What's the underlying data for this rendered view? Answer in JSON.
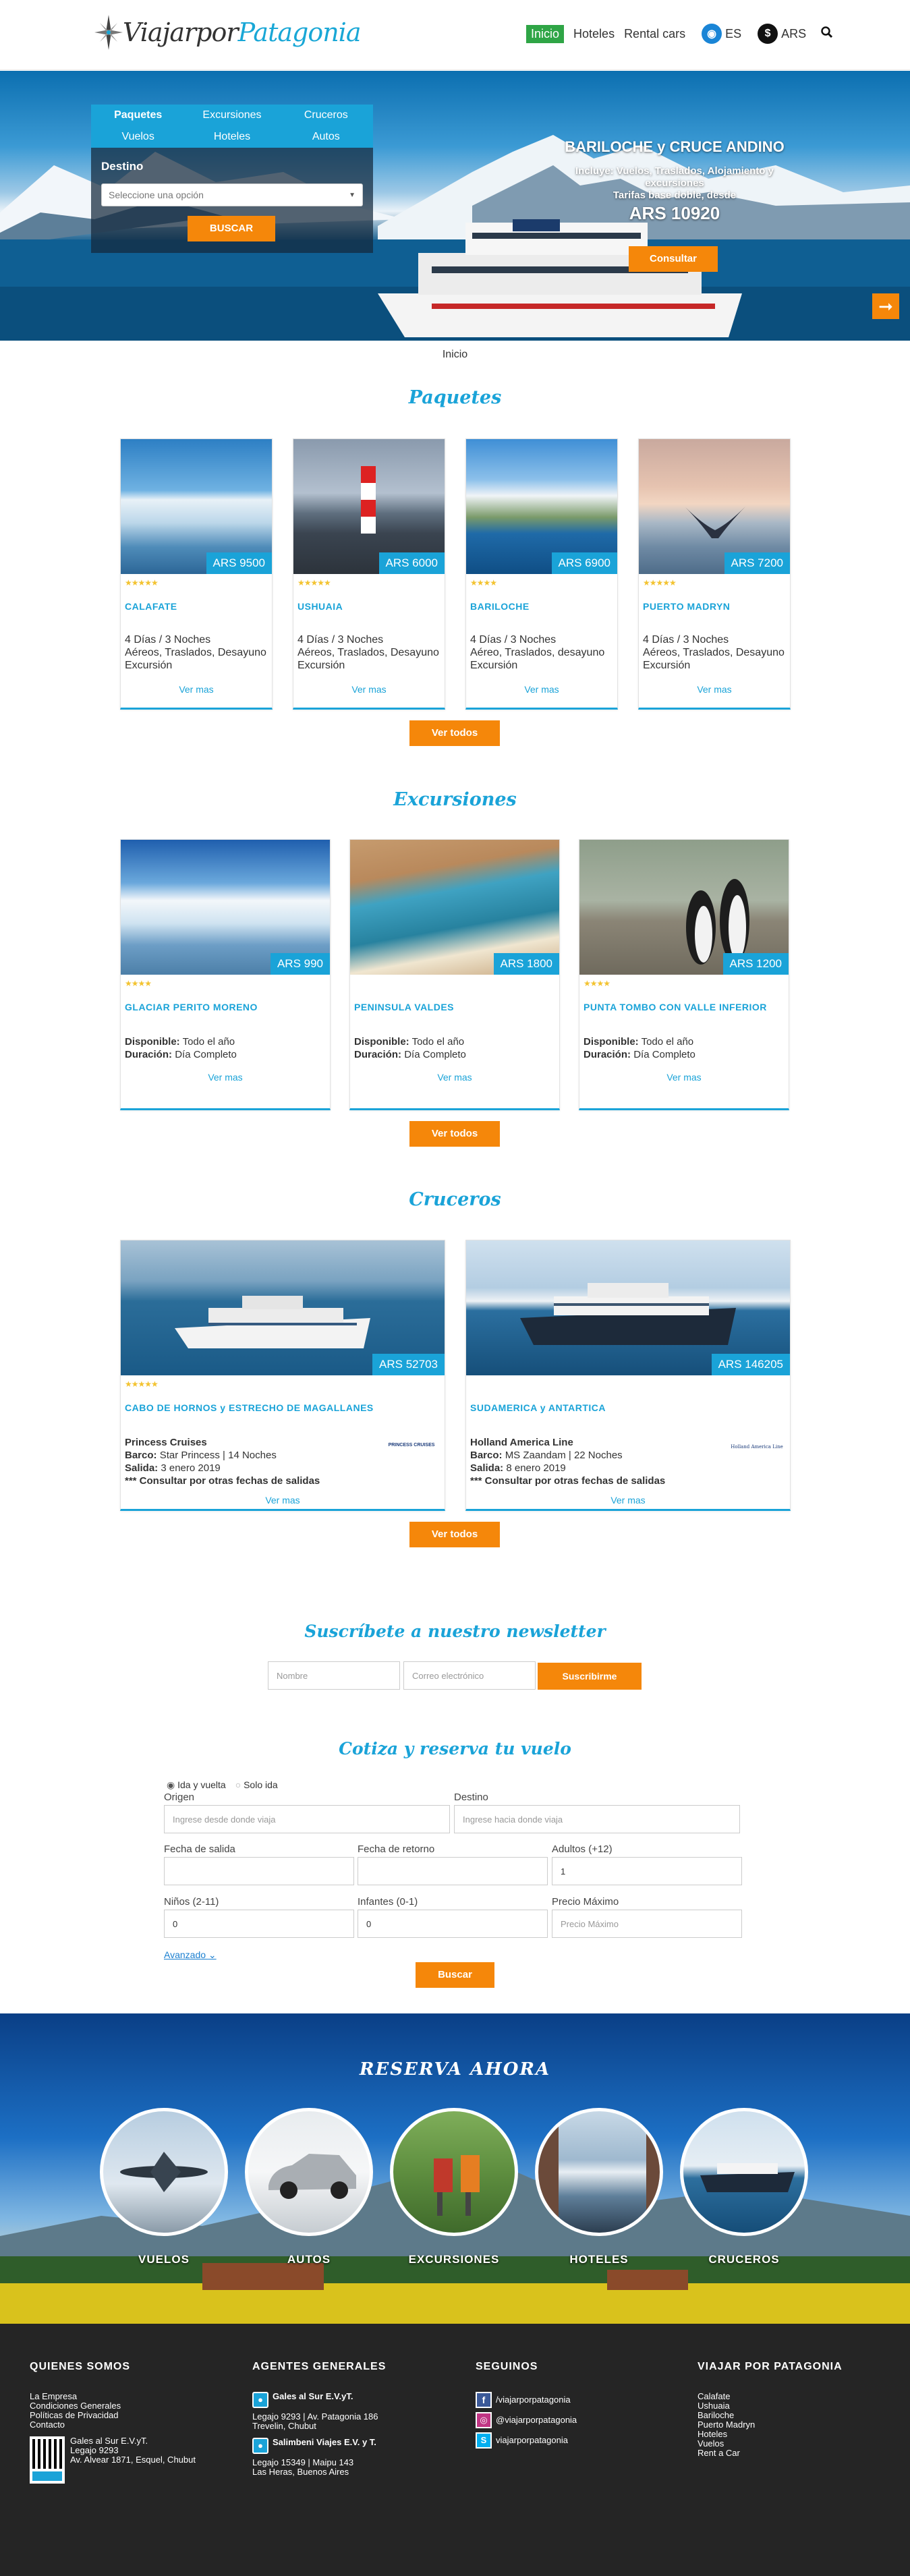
{
  "header": {
    "logo_part1": "Viajarpor",
    "logo_part2": "Patagonia",
    "nav": [
      "Inicio",
      "Hoteles",
      "Rental cars"
    ],
    "lang": "ES",
    "currency": "ARS"
  },
  "hero": {
    "tabs": [
      "Paquetes",
      "Excursiones",
      "Cruceros",
      "Vuelos",
      "Hoteles",
      "Autos"
    ],
    "destino_label": "Destino",
    "destino_placeholder": "Seleccione una opción",
    "buscar": "BUSCAR",
    "promo_title": "BARILOCHE y CRUCE ANDINO",
    "promo_sub1": "Incluye: Vuelos, Traslados, Alojamiento y excursiones",
    "promo_sub2": "Tarifas base doble, desde",
    "promo_price": "ARS 10920",
    "consultar": "Consultar"
  },
  "breadcrumb": "Inicio",
  "paquetes": {
    "title": "Paquetes",
    "items": [
      {
        "name": "CALAFATE",
        "price": "ARS 9500",
        "l1": "4 Días / 3 Noches",
        "l2": "Aéreos, Traslados, Desayuno",
        "l3": "Excursión",
        "more": "Ver mas"
      },
      {
        "name": "USHUAIA",
        "price": "ARS 6000",
        "l1": "4 Días / 3 Noches",
        "l2": "Aéreos, Traslados, Desayuno",
        "l3": "Excursión",
        "more": "Ver mas"
      },
      {
        "name": "BARILOCHE",
        "price": "ARS 6900",
        "l1": "4 Días / 3 Noches",
        "l2": "Aéreo, Traslados, desayuno",
        "l3": "Excursión",
        "more": "Ver mas"
      },
      {
        "name": "PUERTO MADRYN",
        "price": "ARS 7200",
        "l1": "4 Días / 3 Noches",
        "l2": "Aéreos, Traslados, Desayuno",
        "l3": "Excursión",
        "more": "Ver mas"
      }
    ],
    "ver_todos": "Ver todos"
  },
  "excursiones": {
    "title": "Excursiones",
    "disp_label": "Disponible:",
    "dur_label": "Duración:",
    "items": [
      {
        "name": "GLACIAR PERITO MORENO",
        "price": "ARS 990",
        "disp": "Todo el año",
        "dur": "Día Completo",
        "more": "Ver mas"
      },
      {
        "name": "PENINSULA VALDES",
        "price": "ARS 1800",
        "disp": "Todo el año",
        "dur": "Día Completo",
        "more": "Ver mas"
      },
      {
        "name": "PUNTA TOMBO CON VALLE INFERIOR",
        "price": "ARS 1200",
        "disp": "Todo el año",
        "dur": "Día Completo",
        "more": "Ver mas"
      }
    ],
    "ver_todos": "Ver todos"
  },
  "cruceros": {
    "title": "Cruceros",
    "barco_label": "Barco:",
    "salida_label": "Salida:",
    "items": [
      {
        "name": "CABO DE HORNOS y ESTRECHO DE MAGALLANES",
        "price": "ARS 52703",
        "line": "Princess Cruises",
        "barco": "Star Princess | 14 Noches",
        "salida": "3 enero 2019",
        "note": "*** Consultar por otras fechas de salidas",
        "logo": "PRINCESS CRUISES",
        "more": "Ver mas"
      },
      {
        "name": "SUDAMERICA y ANTARTICA",
        "price": "ARS 146205",
        "line": "Holland America Line",
        "barco": "MS Zaandam | 22 Noches",
        "salida": "8 enero 2019",
        "note": "*** Consultar por otras fechas de salidas",
        "logo": "Holland America Line",
        "more": "Ver mas"
      }
    ],
    "ver_todos": "Ver todos"
  },
  "newsletter": {
    "title": "Suscríbete a nuestro newsletter",
    "name_ph": "Nombre",
    "email_ph": "Correo electrónico",
    "submit": "Suscribirme"
  },
  "vuelo": {
    "title": "Cotiza y reserva tu vuelo",
    "ida_vuelta": "Ida y vuelta",
    "solo_ida": "Solo ida",
    "origen": "Origen",
    "origen_ph": "Ingrese desde donde viaja",
    "destino": "Destino",
    "destino_ph": "Ingrese hacia donde viaja",
    "fecha_salida": "Fecha de salida",
    "fecha_retorno": "Fecha de retorno",
    "adultos": "Adultos (+12)",
    "adultos_val": "1",
    "ninos": "Niños (2-11)",
    "ninos_val": "0",
    "infantes": "Infantes (0-1)",
    "infantes_val": "0",
    "precio": "Precio Máximo",
    "precio_ph": "Precio Máximo",
    "avanzado": "Avanzado",
    "buscar": "Buscar"
  },
  "reserva": {
    "title": "RESERVA AHORA",
    "items": [
      "VUELOS",
      "AUTOS",
      "EXCURSIONES",
      "HOTELES",
      "CRUCEROS"
    ]
  },
  "footer": {
    "c1_title": "QUIENES SOMOS",
    "c1_links": [
      "La Empresa",
      "Condiciones Generales",
      "Políticas de Privacidad",
      "Contacto"
    ],
    "c1_legal1": "Gales al Sur E.V.yT.",
    "c1_legal2": "Legajo 9293",
    "c1_legal3": "Av. Alvear 1871, Esquel, Chubut",
    "c2_title": "AGENTES GENERALES",
    "ag1_name": "Gales al Sur E.V.yT.",
    "ag1_l1": "Legajo 9293 | Av. Patagonia 186",
    "ag1_l2": "Trevelin, Chubut",
    "ag2_name": "Salimbeni Viajes E.V. y T.",
    "ag2_l1": "Legajo 15349 | Maipu 143",
    "ag2_l2": "Las Heras, Buenos Aires",
    "c3_title": "SEGUINOS",
    "social": [
      "/viajarporpatagonia",
      "@viajarporpatagonia",
      "viajarporpatagonia"
    ],
    "c4_title": "VIAJAR POR PATAGONIA",
    "c4_links": [
      "Calafate",
      "Ushuaia",
      "Bariloche",
      "Puerto Madryn",
      "Hoteles",
      "Vuelos",
      "Rent a Car"
    ]
  },
  "colors": {
    "accent": "#1aa3d8",
    "orange": "#f5870a",
    "green": "#2fa546",
    "footer": "#252525"
  }
}
